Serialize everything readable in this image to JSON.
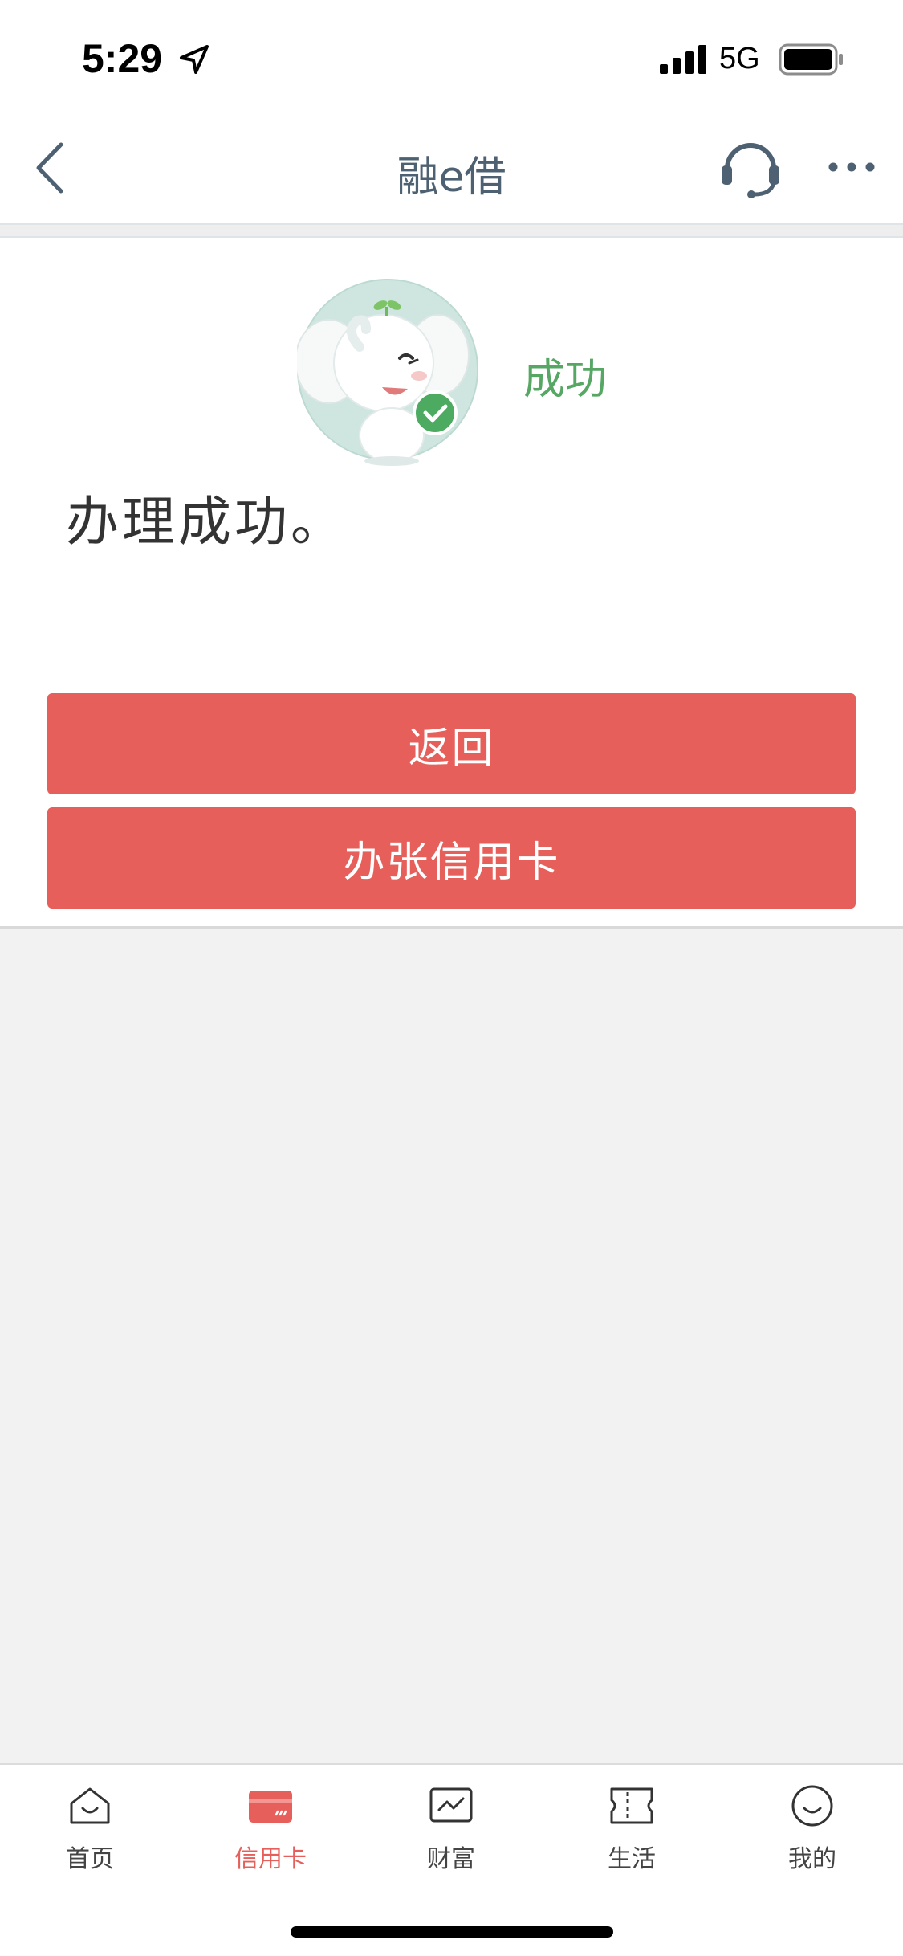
{
  "status_bar": {
    "time": "5:29",
    "network": "5G",
    "icons": [
      "location-arrow-icon",
      "signal-icon",
      "battery-icon"
    ]
  },
  "nav": {
    "title": "融e借",
    "icons": [
      "back-chevron-icon",
      "headset-icon",
      "more-icon"
    ]
  },
  "result": {
    "status_label": "成功",
    "message": "办理成功。",
    "status_color": "#56a664"
  },
  "buttons": {
    "back_label": "返回",
    "apply_card_label": "办张信用卡",
    "color": "#e65f5a"
  },
  "tab_bar": {
    "active_color": "#e65f5a",
    "items": [
      {
        "label": "首页",
        "icon": "home-icon"
      },
      {
        "label": "信用卡",
        "icon": "credit-card-icon",
        "active": true
      },
      {
        "label": "财富",
        "icon": "wealth-chart-icon"
      },
      {
        "label": "生活",
        "icon": "ticket-icon"
      },
      {
        "label": "我的",
        "icon": "smiley-icon"
      }
    ]
  }
}
